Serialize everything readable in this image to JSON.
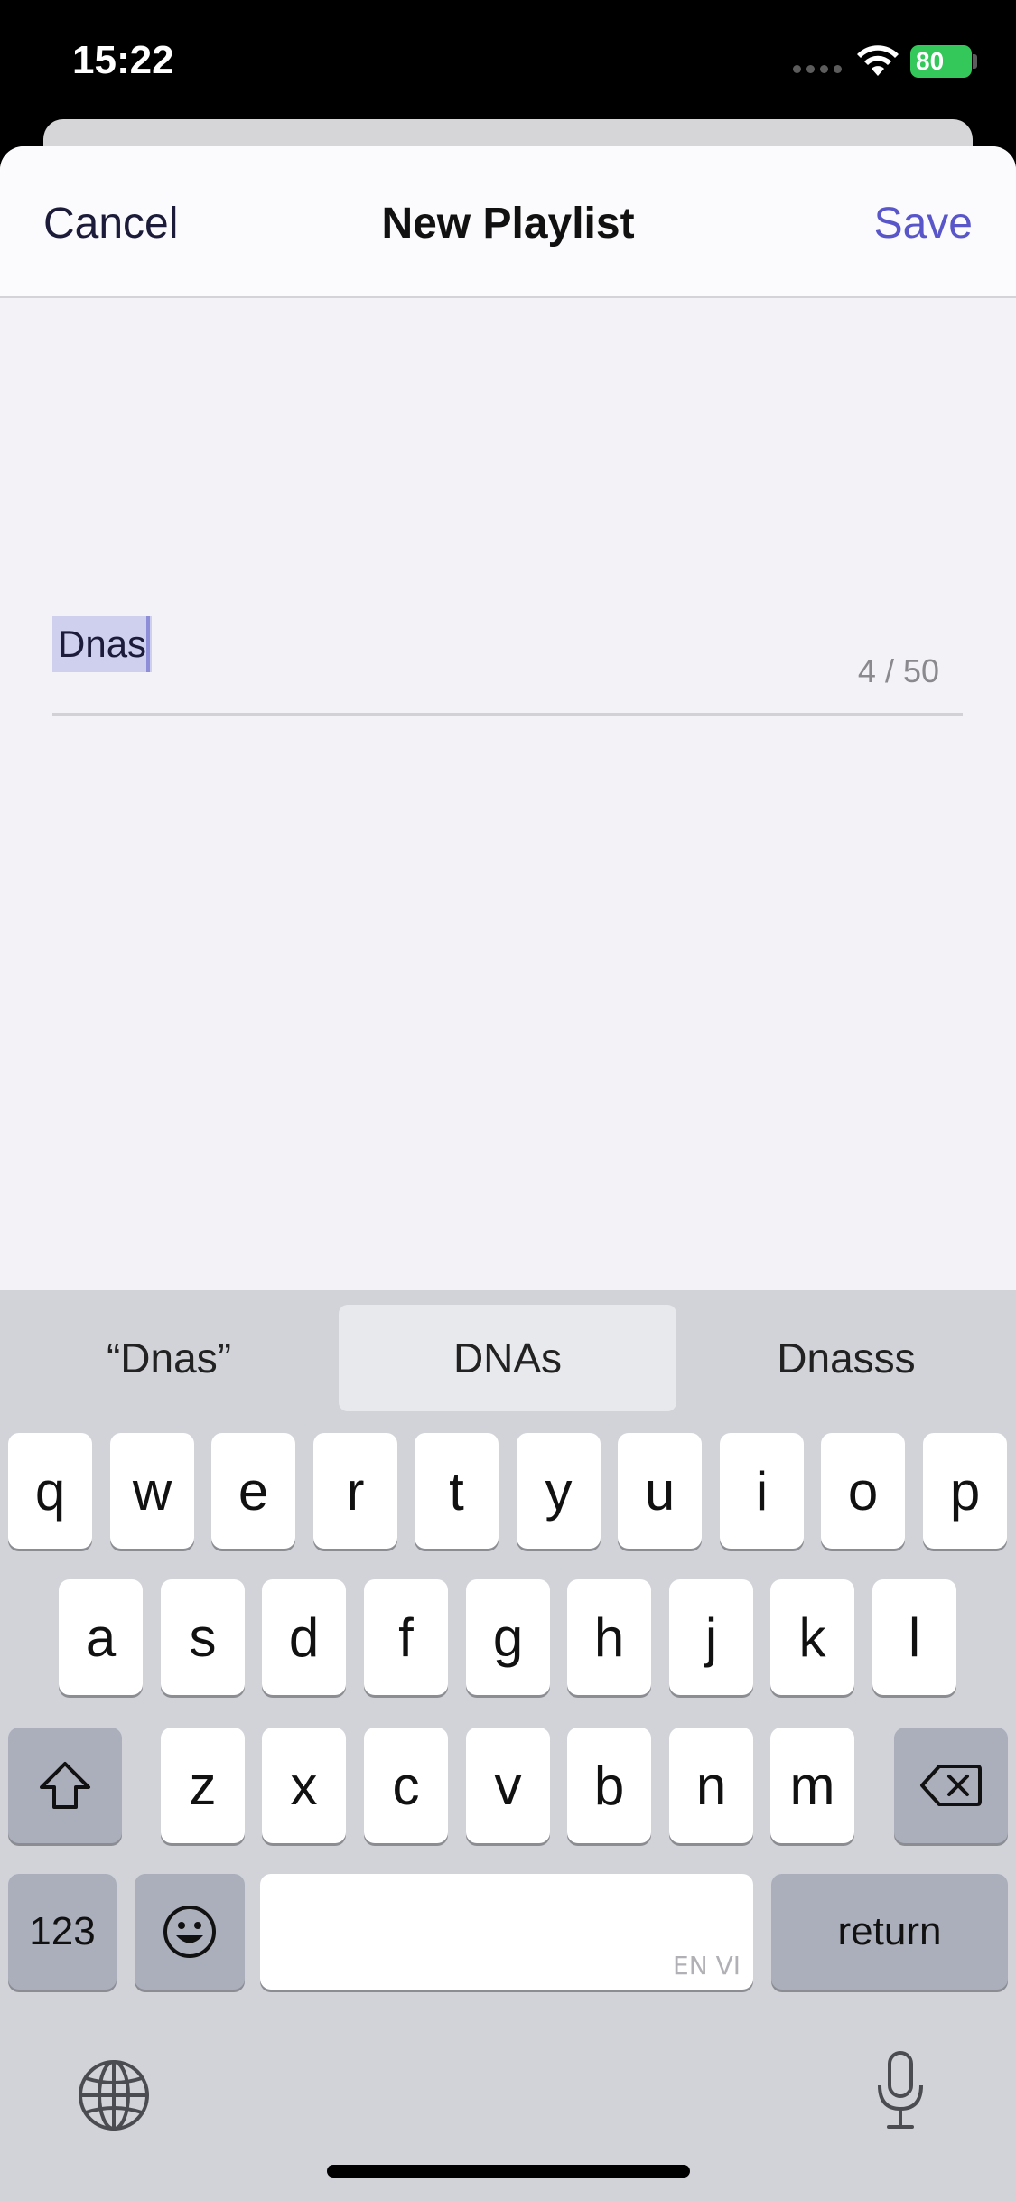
{
  "status_bar": {
    "time": "15:22",
    "battery": "80"
  },
  "nav": {
    "cancel_label": "Cancel",
    "title": "New Playlist",
    "save_label": "Save"
  },
  "name_field": {
    "value": "Dnas",
    "char_count": "4 / 50"
  },
  "keyboard": {
    "suggestions": [
      "“Dnas”",
      "DNAs",
      "Dnasss"
    ],
    "row1": [
      "q",
      "w",
      "e",
      "r",
      "t",
      "y",
      "u",
      "i",
      "o",
      "p"
    ],
    "row2": [
      "a",
      "s",
      "d",
      "f",
      "g",
      "h",
      "j",
      "k",
      "l"
    ],
    "row3": [
      "z",
      "x",
      "c",
      "v",
      "b",
      "n",
      "m"
    ],
    "numbers_label": "123",
    "return_label": "return",
    "space_tag": "EN VI"
  },
  "colors": {
    "accent": "#5856c9",
    "battery": "#34c759"
  }
}
